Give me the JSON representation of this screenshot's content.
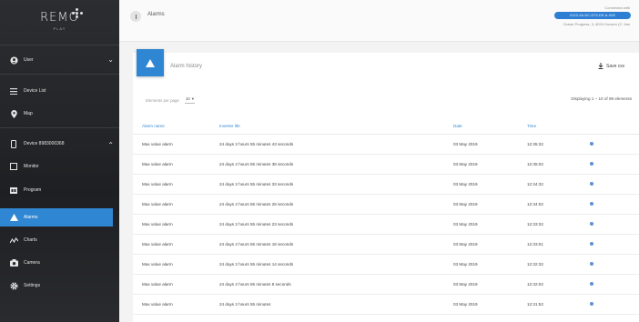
{
  "brand": {
    "name": "REMO",
    "sub": "PLAY"
  },
  "sidebar": {
    "user": "User",
    "items": [
      {
        "label": "Device List"
      },
      {
        "label": "Map"
      },
      {
        "label": "Device 8983000368"
      },
      {
        "label": "Monitor"
      },
      {
        "label": "Program"
      },
      {
        "label": "Alarms"
      },
      {
        "label": "Charts"
      },
      {
        "label": "Camera"
      },
      {
        "label": "Settings"
      }
    ]
  },
  "header": {
    "title": "Alarms",
    "connected_label": "Connected with",
    "connection_id": "0123-2A-DC-D73-DS-A-X00",
    "path": "Ocean Progress, 3, 8024 Hooven (C. Itus"
  },
  "card": {
    "title": "Alarm history",
    "save_label": "Save csv",
    "per_page_label": "Elements per page",
    "per_page_value": "10",
    "displaying": "Displaying 1 – 10 of 89 elements"
  },
  "table": {
    "columns": [
      "Alarm name",
      "Inverter life",
      "Date",
      "Time"
    ],
    "rows": [
      {
        "name": "Max value alarm",
        "life": "24 days 2 hours 55 minutes 43 seconds",
        "date": "03 May 2019",
        "time": "12:35:32"
      },
      {
        "name": "Max value alarm",
        "life": "24 days 2 hours 55 minutes 38 seconds",
        "date": "03 May 2019",
        "time": "12:35:02"
      },
      {
        "name": "Max value alarm",
        "life": "24 days 2 hours 55 minutes 33 seconds",
        "date": "03 May 2019",
        "time": "12:34:32"
      },
      {
        "name": "Max value alarm",
        "life": "24 days 2 hours 55 minutes 28 seconds",
        "date": "03 May 2019",
        "time": "12:34:02"
      },
      {
        "name": "Max value alarm",
        "life": "24 days 2 hours 55 minutes 23 seconds",
        "date": "03 May 2019",
        "time": "12:33:32"
      },
      {
        "name": "Max value alarm",
        "life": "24 days 2 hours 55 minutes 18 seconds",
        "date": "03 May 2019",
        "time": "12:33:01"
      },
      {
        "name": "Max value alarm",
        "life": "24 days 2 hours 55 minutes 14 seconds",
        "date": "03 May 2019",
        "time": "12:32:32"
      },
      {
        "name": "Max value alarm",
        "life": "24 days 2 hours 55 minutes 8 seconds",
        "date": "03 May 2019",
        "time": "12:32:02"
      },
      {
        "name": "Max value alarm",
        "life": "24 days 2 hours 55 minutes",
        "date": "03 May 2019",
        "time": "12:31:52"
      }
    ]
  },
  "colors": {
    "accent": "#2f86d2",
    "sidebar_bg": "#232427"
  }
}
